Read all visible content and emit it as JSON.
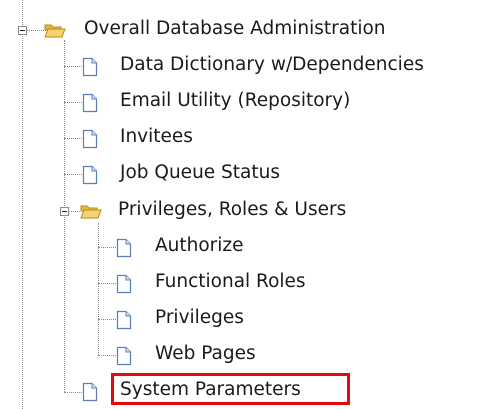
{
  "tree": {
    "root": {
      "label": "Overall Database Administration",
      "icon": "folder-open-icon",
      "expanded": true
    },
    "items": [
      {
        "label": "Data Dictionary w/Dependencies",
        "icon": "document-icon"
      },
      {
        "label": "Email Utility (Repository)",
        "icon": "document-icon"
      },
      {
        "label": "Invitees",
        "icon": "document-icon"
      },
      {
        "label": "Job Queue Status",
        "icon": "document-icon"
      }
    ],
    "subfolder": {
      "label": "Privileges, Roles & Users",
      "icon": "folder-open-icon",
      "expanded": true,
      "items": [
        {
          "label": "Authorize",
          "icon": "document-icon"
        },
        {
          "label": "Functional Roles",
          "icon": "document-icon"
        },
        {
          "label": "Privileges",
          "icon": "document-icon"
        },
        {
          "label": "Web Pages",
          "icon": "document-icon"
        }
      ]
    },
    "last_item": {
      "label": "System Parameters",
      "icon": "document-icon",
      "highlighted": true
    }
  },
  "colors": {
    "highlight_border": "#e4080a",
    "folder_fill": "#f4d270",
    "doc_border": "#5a7fb8"
  }
}
